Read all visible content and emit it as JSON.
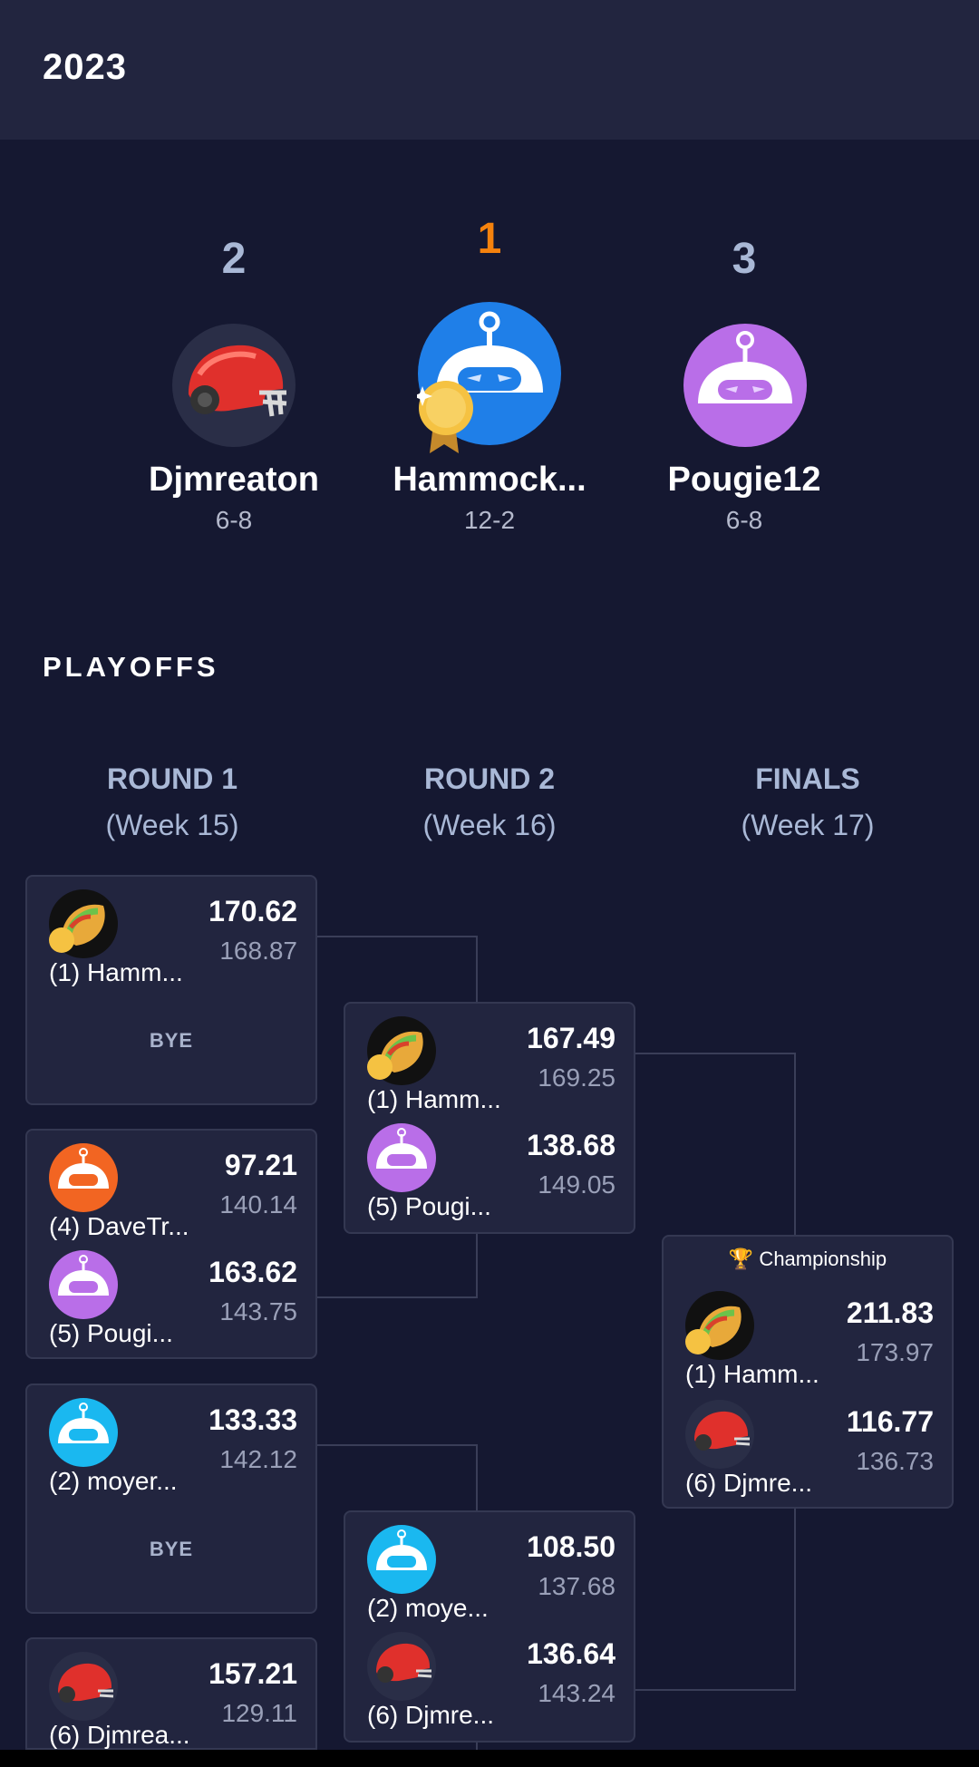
{
  "header": {
    "year": "2023"
  },
  "podium": {
    "second": {
      "rank": "2",
      "name": "Djmreaton",
      "record": "6-8",
      "avatar_icon": "football-helmet-icon"
    },
    "first": {
      "rank": "1",
      "name": "Hammock...",
      "record": "12-2",
      "avatar_icon": "blue-robot-icon",
      "badge_icon": "gold-medal-icon"
    },
    "third": {
      "rank": "3",
      "name": "Pougie12",
      "record": "6-8",
      "avatar_icon": "purple-robot-icon"
    }
  },
  "playoffs": {
    "title": "PLAYOFFS",
    "rounds": [
      {
        "name": "ROUND 1",
        "week": "(Week 15)"
      },
      {
        "name": "ROUND 2",
        "week": "(Week 16)"
      },
      {
        "name": "FINALS",
        "week": "(Week 17)"
      }
    ],
    "round1": [
      {
        "top": {
          "name": "(1) Hamm...",
          "score": "170.62",
          "proj": "168.87",
          "avatar_icon": "taco-icon"
        },
        "bye_label": "BYE"
      },
      {
        "top": {
          "name": "(4) DaveTr...",
          "score": "97.21",
          "proj": "140.14",
          "avatar_icon": "orange-robot-icon"
        },
        "bottom": {
          "name": "(5) Pougi...",
          "score": "163.62",
          "proj": "143.75",
          "avatar_icon": "purple-robot-icon"
        }
      },
      {
        "top": {
          "name": "(2) moyer...",
          "score": "133.33",
          "proj": "142.12",
          "avatar_icon": "cyan-robot-icon"
        },
        "bye_label": "BYE"
      },
      {
        "top": {
          "name": "(6) Djmrea...",
          "score": "157.21",
          "proj": "129.11",
          "avatar_icon": "football-helmet-icon"
        }
      }
    ],
    "round2": [
      {
        "top": {
          "name": "(1) Hamm...",
          "score": "167.49",
          "proj": "169.25",
          "avatar_icon": "taco-icon"
        },
        "bottom": {
          "name": "(5) Pougi...",
          "score": "138.68",
          "proj": "149.05",
          "avatar_icon": "purple-robot-icon"
        }
      },
      {
        "top": {
          "name": "(2) moye...",
          "score": "108.50",
          "proj": "137.68",
          "avatar_icon": "cyan-robot-icon"
        },
        "bottom": {
          "name": "(6) Djmre...",
          "score": "136.64",
          "proj": "143.24",
          "avatar_icon": "football-helmet-icon"
        }
      }
    ],
    "finals": {
      "label": "🏆 Championship",
      "top": {
        "name": "(1) Hamm...",
        "score": "211.83",
        "proj": "173.97",
        "avatar_icon": "taco-icon"
      },
      "bottom": {
        "name": "(6) Djmre...",
        "score": "116.77",
        "proj": "136.73",
        "avatar_icon": "football-helmet-icon"
      }
    }
  },
  "colors": {
    "background": "#151831",
    "header": "#22253f",
    "card": "#22253f",
    "rank_first": "#f5820d",
    "rank_other": "#a9b8d6",
    "blue_robot": "#1f7fe8",
    "purple_robot": "#b96ee8",
    "orange_robot": "#f26522",
    "cyan_robot": "#1ab8f0"
  }
}
